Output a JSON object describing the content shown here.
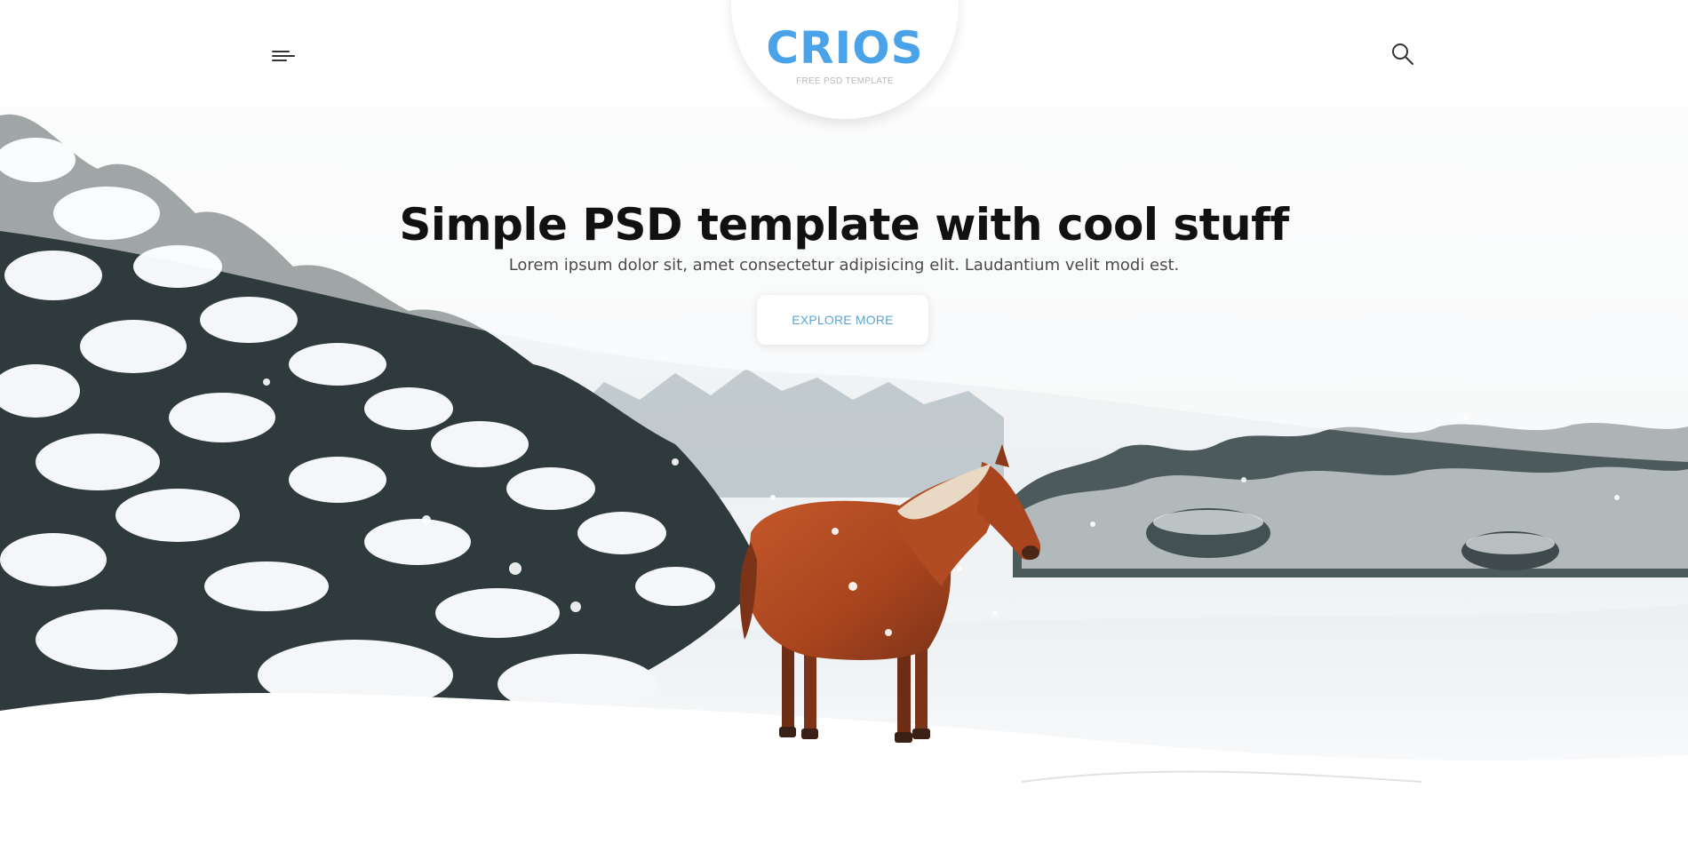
{
  "colors": {
    "accent": "#4aa3e8",
    "title": "#111111",
    "subtitle": "#4a4a4a",
    "tagline": "#b9b9b9",
    "button_text": "#5ba6d6",
    "icon": "#333333"
  },
  "header": {
    "logo": "CRIOS",
    "tagline": "FREE PSD TEMPLATE",
    "menu_icon": "hamburger-menu-icon",
    "search_icon": "search-icon"
  },
  "hero": {
    "title": "Simple PSD template with cool stuff",
    "subtitle": "Lorem ipsum dolor sit, amet consectetur adipisicing elit. Laudantium velit modi est.",
    "cta_label": "EXPLORE MORE"
  }
}
